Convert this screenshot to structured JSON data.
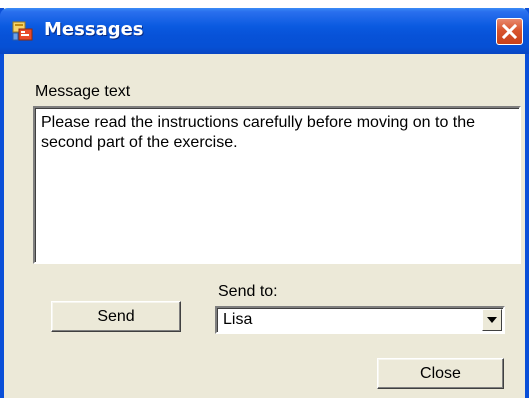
{
  "window": {
    "title": "Messages",
    "icon": "messages-app-icon",
    "close_icon": "close-icon"
  },
  "message": {
    "label": "Message text",
    "text": "Please read the instructions carefully before moving on to the second part of the exercise."
  },
  "send_to": {
    "label": "Send to:",
    "selected": "Lisa",
    "arrow_icon": "dropdown-arrow-icon"
  },
  "buttons": {
    "send": "Send",
    "close": "Close"
  },
  "colors": {
    "titlebar": "#0752d8",
    "frame": "#0a4fd8",
    "body": "#ece9d8",
    "close_button": "#d8552e"
  }
}
